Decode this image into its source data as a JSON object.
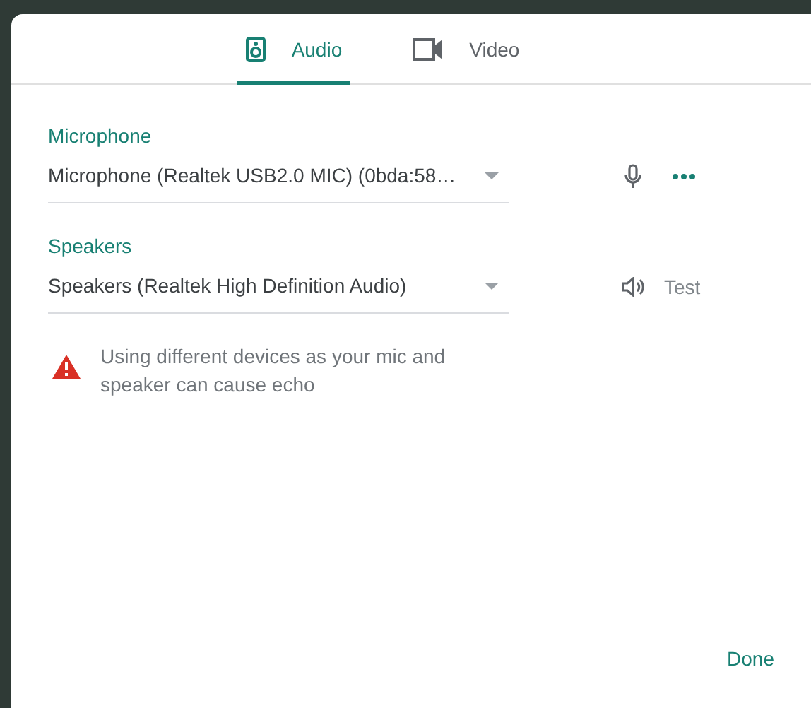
{
  "tabs": [
    {
      "label": "Audio",
      "kind": "audio",
      "selected": true
    },
    {
      "label": "Video",
      "kind": "video",
      "selected": false
    }
  ],
  "devices": [
    {
      "label": "Microphone",
      "value": "Microphone (Realtek USB2.0 MIC) (0bda:58…",
      "kind": "mic"
    },
    {
      "label": "Speakers",
      "value": "Speakers (Realtek High Definition Audio)",
      "kind": "speaker",
      "action": "Test"
    }
  ],
  "warning": "Using different devices as your mic and speaker can cause echo",
  "done_button": "Done"
}
